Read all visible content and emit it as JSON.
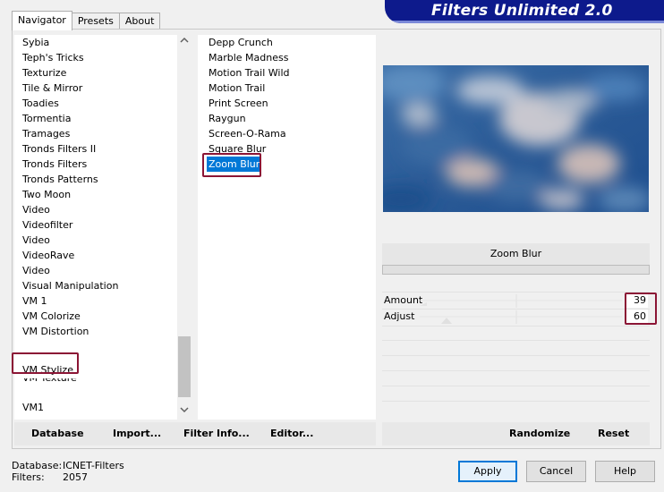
{
  "title": "Filters Unlimited 2.0",
  "tabs": [
    {
      "label": "Navigator",
      "active": true
    },
    {
      "label": "Presets",
      "active": false
    },
    {
      "label": "About",
      "active": false
    }
  ],
  "categories": [
    "Sybia",
    "Teph's Tricks",
    "Texturize",
    "Tile & Mirror",
    "Toadies",
    "Tormentia",
    "Tramages",
    "Tronds Filters II",
    "Tronds Filters",
    "Tronds Patterns",
    "Two Moon",
    "Video",
    "Videofilter",
    "Video",
    "VideoRave",
    "Video",
    "Visual Manipulation",
    "VM 1",
    "VM Colorize",
    "VM Distortion",
    "VM Stylize",
    "VM Texture",
    "VM1"
  ],
  "selected_category": "VM Stylize",
  "filters": [
    "Depp Crunch",
    "Marble Madness",
    "Motion Trail Wild",
    "Motion Trail",
    "Print Screen",
    "Raygun",
    "Screen-O-Rama",
    "Square Blur",
    "Zoom Blur"
  ],
  "selected_filter": "Zoom Blur",
  "filter_name": "Zoom Blur",
  "params": [
    {
      "label": "Amount",
      "value": "39"
    },
    {
      "label": "Adjust",
      "value": "60"
    }
  ],
  "left_buttons": [
    "Database",
    "Import...",
    "Filter Info...",
    "Editor..."
  ],
  "right_buttons": [
    "Randomize",
    "Reset"
  ],
  "status": {
    "database_label": "Database:",
    "database_value": "ICNET-Filters",
    "filters_label": "Filters:",
    "filters_value": "2057"
  },
  "dialog_buttons": [
    "Apply",
    "Cancel",
    "Help"
  ],
  "icons": {
    "scroll_up": "chevron-up-icon",
    "scroll_down": "chevron-down-icon"
  },
  "colors": {
    "selection": "#0078d7",
    "highlight_box": "#8b1535",
    "title_banner": "#0d1a8c"
  }
}
